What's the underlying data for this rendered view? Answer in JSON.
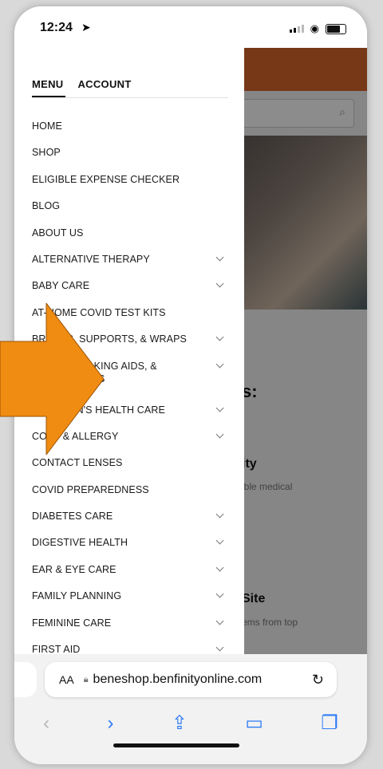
{
  "status": {
    "time": "12:24"
  },
  "drawer": {
    "tabs": [
      "MENU",
      "ACCOUNT"
    ],
    "items": [
      {
        "label": "HOME",
        "chevron": false
      },
      {
        "label": "SHOP",
        "chevron": false
      },
      {
        "label": "ELIGIBLE EXPENSE CHECKER",
        "chevron": false
      },
      {
        "label": "BLOG",
        "chevron": false
      },
      {
        "label": "ABOUT US",
        "chevron": false
      },
      {
        "label": "ALTERNATIVE THERAPY",
        "chevron": true
      },
      {
        "label": "BABY CARE",
        "chevron": true
      },
      {
        "label": "AT-HOME COVID TEST KITS",
        "chevron": false
      },
      {
        "label": "BRACES, SUPPORTS, & WRAPS",
        "chevron": true
      },
      {
        "label": "CANES, WALKING AIDS, & ACCESSORIES",
        "chevron": true
      },
      {
        "label": "CHILDREN'S HEALTH CARE",
        "chevron": true
      },
      {
        "label": "COLD & ALLERGY",
        "chevron": true
      },
      {
        "label": "CONTACT LENSES",
        "chevron": false
      },
      {
        "label": "COVID PREPAREDNESS",
        "chevron": false
      },
      {
        "label": "DIABETES CARE",
        "chevron": true
      },
      {
        "label": "DIGESTIVE HEALTH",
        "chevron": true
      },
      {
        "label": "EAR & EYE CARE",
        "chevron": true
      },
      {
        "label": "FAMILY PLANNING",
        "chevron": true
      },
      {
        "label": "FEMININE CARE",
        "chevron": true
      },
      {
        "label": "FIRST AID",
        "chevron": true
      }
    ]
  },
  "background": {
    "snippets": [
      "s:",
      "ity",
      "ible medical",
      "Site",
      "ems from top"
    ]
  },
  "browser": {
    "text_size": "AA",
    "url": "beneshop.benfinityonline.com"
  },
  "colors": {
    "brand": "#d9672a",
    "accent": "#2f7cf6",
    "arrow": "#f08c12"
  },
  "icons": [
    "location-arrow-icon",
    "signal-icon",
    "wifi-icon",
    "battery-icon",
    "search-icon",
    "chevron-down-icon",
    "lock-icon",
    "reload-icon",
    "back-icon",
    "forward-icon",
    "share-icon",
    "bookmarks-icon",
    "tabs-icon"
  ]
}
